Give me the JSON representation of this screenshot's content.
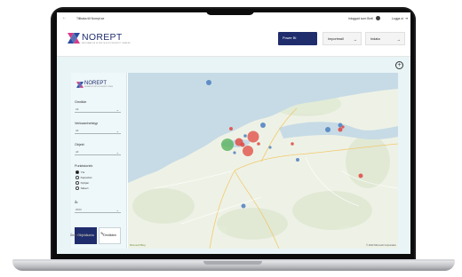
{
  "topbar": {
    "back_symbol": "←",
    "crumb": "Tillbaka till Norept.se",
    "login_status": "Inloggad som Brell",
    "logout_label": "Logga ut",
    "logout_symbol": "⇥"
  },
  "header": {
    "logo_text": "NOREPT",
    "logo_sub": "INFORMATION IN DEPTH FOR PROPERTY OWNERS",
    "nav": [
      {
        "label": "Power BI",
        "arrow": ""
      },
      {
        "label": "Importmall",
        "arrow": "→"
      },
      {
        "label": "Indata",
        "arrow": "→"
      }
    ]
  },
  "content": {
    "add_symbol": "+"
  },
  "panel": {
    "logo_text": "NOREPT",
    "logo_sub": "INFORMATION IN DEPTH FOR PROPERTY OWNERS",
    "filters": [
      {
        "label": "Område",
        "value": "All"
      },
      {
        "label": "Verksamhetstyp",
        "value": "All"
      },
      {
        "label": "Objekt",
        "value": "All"
      }
    ],
    "radio_group": {
      "label": "Punktstorlek",
      "options": [
        {
          "label": "Yta",
          "selected": true
        },
        {
          "label": "Kapacitet",
          "selected": false
        },
        {
          "label": "Nyttjan",
          "selected": false
        },
        {
          "label": "Säkert",
          "selected": false
        }
      ]
    },
    "year": {
      "label": "År",
      "value": "2023"
    },
    "btn_objekt": "Objektkarta",
    "btn_omrade": "Områden",
    "reset": "Återställ filter/sjuer",
    "eraser_icon": "eraser-icon"
  },
  "map": {
    "provider": "Microsoft Bing",
    "copyright": "© 2023 Microsoft Corporation",
    "colors": {
      "water": "#c7dbe6",
      "land": "#eef2e6",
      "red": "#e0473f",
      "blue": "#4c7fc0",
      "green": "#58b25c"
    }
  }
}
